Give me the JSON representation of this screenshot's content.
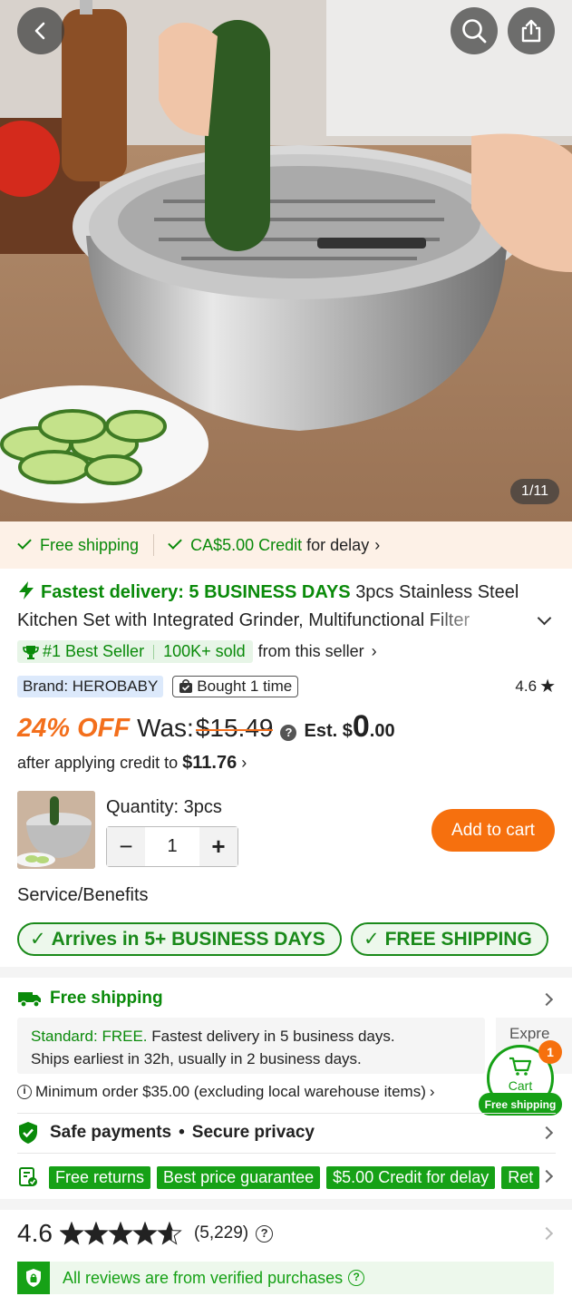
{
  "gallery": {
    "counter": "1/11"
  },
  "shipping_strip": {
    "free_shipping": "Free shipping",
    "credit_amount": "CA$5.00 Credit",
    "credit_suffix": "for delay"
  },
  "product": {
    "fastest_delivery": "Fastest delivery: 5 BUSINESS DAYS",
    "title": "3pcs Stainless Steel Kitchen Set with Integrated Grinder, Multifunctional Filter",
    "best_seller": "#1 Best Seller",
    "sold": "100K+ sold",
    "from_seller": "from this seller",
    "brand": "Brand: HEROBABY",
    "bought": "Bought 1 time",
    "rating": "4.6"
  },
  "price": {
    "discount": "24% OFF",
    "was_label": "Was:",
    "was_price": "$15.49",
    "est_label": "Est. $",
    "est_big": "0",
    "est_cents": ".00",
    "after_credit_text": "after applying credit to",
    "after_credit_price": "$11.76"
  },
  "purchase": {
    "quantity_label": "Quantity: 3pcs",
    "quantity_value": "1",
    "minus": "−",
    "plus": "+",
    "add_to_cart": "Add to cart"
  },
  "service": {
    "title": "Service/Benefits",
    "pill_arrives": "Arrives in 5+ BUSINESS DAYS",
    "pill_free_shipping": "FREE SHIPPING"
  },
  "shipping_section": {
    "title": "Free shipping",
    "standard_label": "Standard: FREE.",
    "standard_text": "Fastest delivery in 5 business days.",
    "standard_line2": "Ships earliest in 32h, usually in 2 business days.",
    "express_label": "Expre",
    "min_order": "Minimum order $35.00 (excluding local warehouse items)"
  },
  "cart_float": {
    "label": "Cart",
    "badge": "1",
    "free": "Free shipping"
  },
  "safety": {
    "payments": "Safe payments",
    "dot": "•",
    "privacy": "Secure privacy"
  },
  "tags": [
    "Free returns",
    "Best price guarantee",
    "$5.00 Credit for delay",
    "Ret"
  ],
  "reviews": {
    "score": "4.6",
    "count": "(5,229)",
    "stars_value": 4.6,
    "verified": "All reviews are from verified purchases"
  },
  "colors": {
    "accent_green": "#0a8a0a",
    "accent_orange": "#f6700e",
    "strip_bg": "#fdf1e7"
  }
}
